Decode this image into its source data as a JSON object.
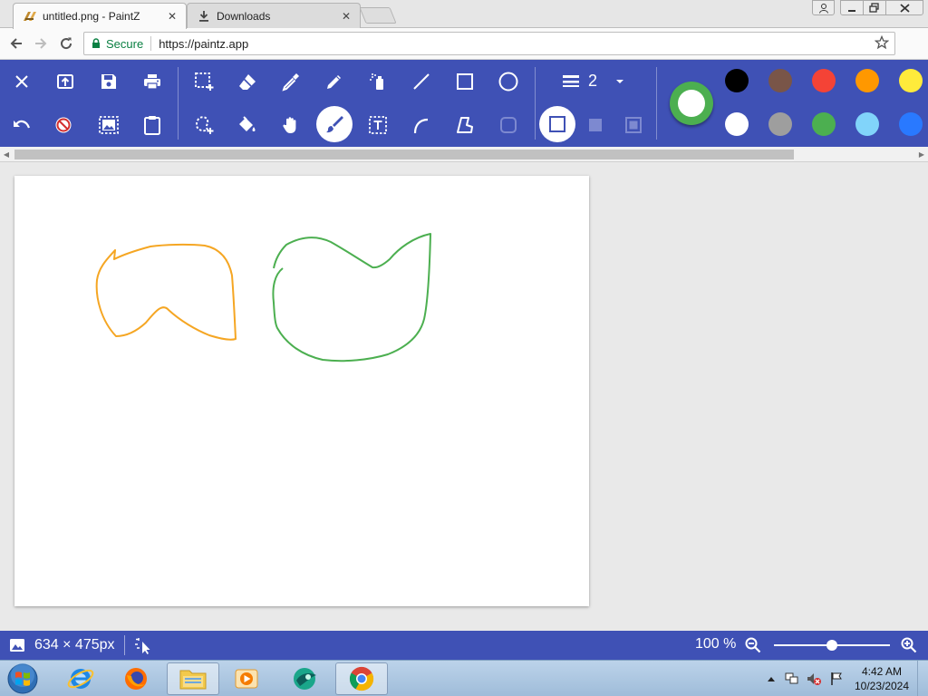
{
  "browser": {
    "tabs": [
      {
        "title": "untitled.png - PaintZ",
        "active": true
      },
      {
        "title": "Downloads",
        "active": false
      }
    ],
    "close_glyph": "✕",
    "omnibox": {
      "secure_label": "Secure",
      "url": "https://paintz.app"
    },
    "icons": [
      "back-icon",
      "forward-icon",
      "reload-icon",
      "lock-icon",
      "star-icon"
    ]
  },
  "toolbar": {
    "row1_tools": [
      "close",
      "open",
      "save",
      "print",
      "rectangle-select",
      "eraser",
      "color-picker",
      "pencil",
      "airbrush",
      "line",
      "rectangle",
      "ellipse"
    ],
    "row2_tools": [
      "undo",
      "clear",
      "select-all",
      "paste",
      "free-form-select",
      "fill",
      "pan",
      "brush",
      "text",
      "curve",
      "polygon",
      "rounded-rectangle"
    ],
    "selected_tool": "brush",
    "line_width": "2",
    "fill_modes": [
      "outline",
      "fill",
      "outline-and-fill"
    ],
    "selected_fill_mode": "outline",
    "current_color": {
      "primary": "#4caf50",
      "secondary": "#ffffff"
    },
    "palette_row1": [
      "#000000",
      "#795548",
      "#f44336",
      "#ff9800",
      "#ffeb3b"
    ],
    "palette_row2": [
      "#ffffff",
      "#9e9e9e",
      "#4caf50",
      "#81d4fa",
      "#2979ff"
    ]
  },
  "canvas": {
    "background": "#ffffff",
    "strokes": [
      {
        "color": "#f5a623"
      },
      {
        "color": "#4caf50"
      }
    ]
  },
  "status": {
    "dimensions": "634 × 475px",
    "zoom": "100 %",
    "zoom_level": 0.5
  },
  "taskbar": {
    "apps": [
      "internet-explorer",
      "firefox",
      "file-explorer",
      "media-player",
      "app-green",
      "chrome"
    ],
    "active_app": "chrome",
    "time": "4:42 AM",
    "date": "10/23/2024"
  }
}
